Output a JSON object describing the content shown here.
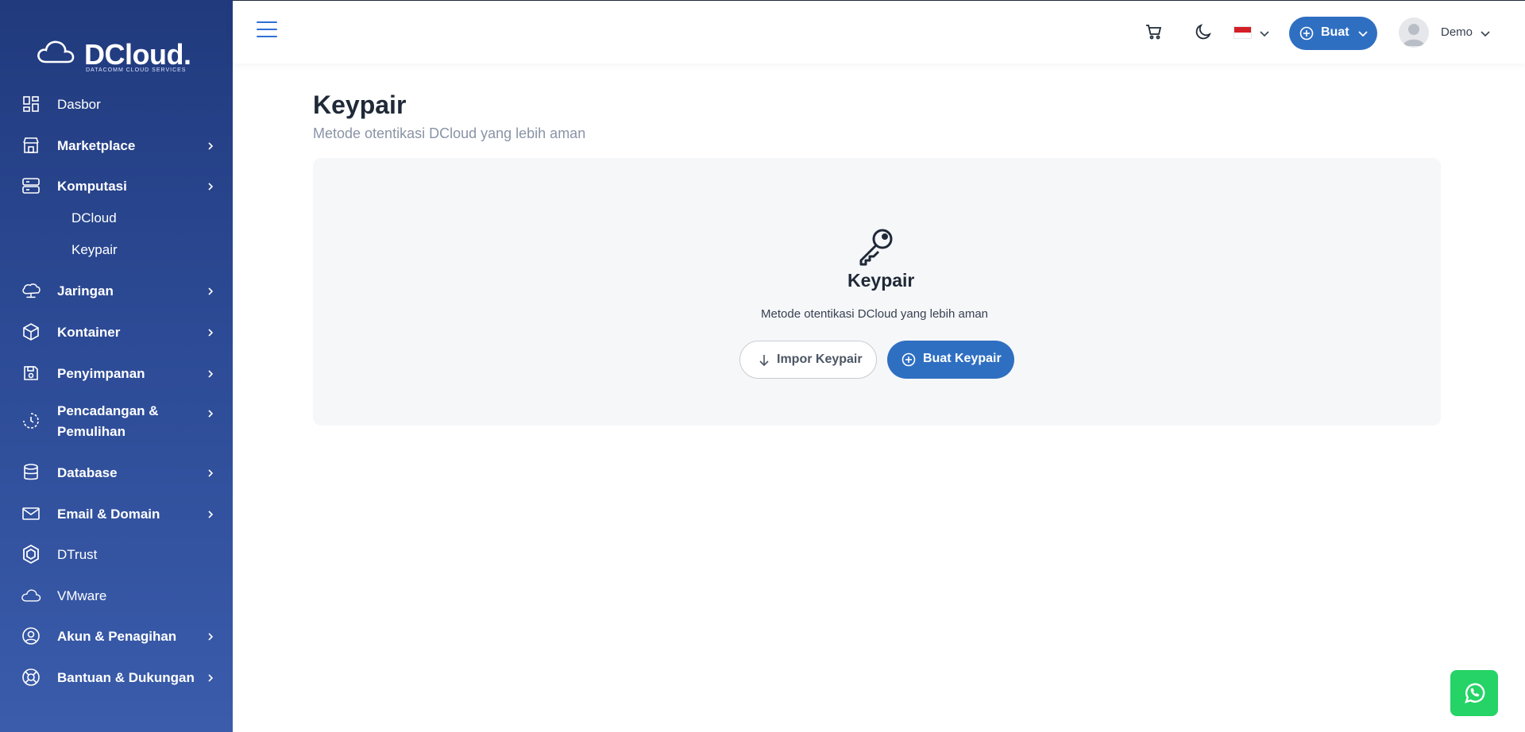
{
  "brand": {
    "name": "DCloud.",
    "tagline": "DATACOMM CLOUD SERVICES"
  },
  "sidebar": {
    "items": [
      {
        "label": "Dasbor",
        "icon": "dashboard-icon",
        "bold": false,
        "chevron": false
      },
      {
        "label": "Marketplace",
        "icon": "store-icon",
        "bold": true,
        "chevron": true
      },
      {
        "label": "Komputasi",
        "icon": "server-icon",
        "bold": true,
        "chevron": true
      },
      {
        "label": "Jaringan",
        "icon": "cloud-network-icon",
        "bold": true,
        "chevron": true
      },
      {
        "label": "Kontainer",
        "icon": "box-icon",
        "bold": true,
        "chevron": true
      },
      {
        "label": "Penyimpanan",
        "icon": "save-icon",
        "bold": true,
        "chevron": true
      },
      {
        "label": "Pencadangan &",
        "label2": "Pemulihan",
        "icon": "backup-icon",
        "bold": true,
        "chevron": true
      },
      {
        "label": "Database",
        "icon": "database-icon",
        "bold": true,
        "chevron": true
      },
      {
        "label": "Email & Domain",
        "icon": "mail-icon",
        "bold": true,
        "chevron": true
      },
      {
        "label": "DTrust",
        "icon": "shield-icon",
        "bold": false,
        "chevron": false
      },
      {
        "label": "VMware",
        "icon": "cloud-icon",
        "bold": false,
        "chevron": false
      },
      {
        "label": "Akun & Penagihan",
        "icon": "user-circle-icon",
        "bold": true,
        "chevron": true
      },
      {
        "label": "Bantuan & Dukungan",
        "icon": "lifebuoy-icon",
        "bold": true,
        "chevron": true
      }
    ],
    "subitems": [
      "DCloud",
      "Keypair"
    ]
  },
  "topbar": {
    "create_label": "Buat",
    "user_name": "Demo",
    "language": "id"
  },
  "page": {
    "title": "Keypair",
    "subtitle": "Metode otentikasi DCloud yang lebih aman"
  },
  "empty_state": {
    "title": "Keypair",
    "subtitle": "Metode otentikasi DCloud yang lebih aman",
    "import_label": "Impor Keypair",
    "create_label": "Buat Keypair"
  },
  "colors": {
    "sidebar": "#2c4a95",
    "accent": "#2f6fc2",
    "whatsapp": "#25d366"
  }
}
